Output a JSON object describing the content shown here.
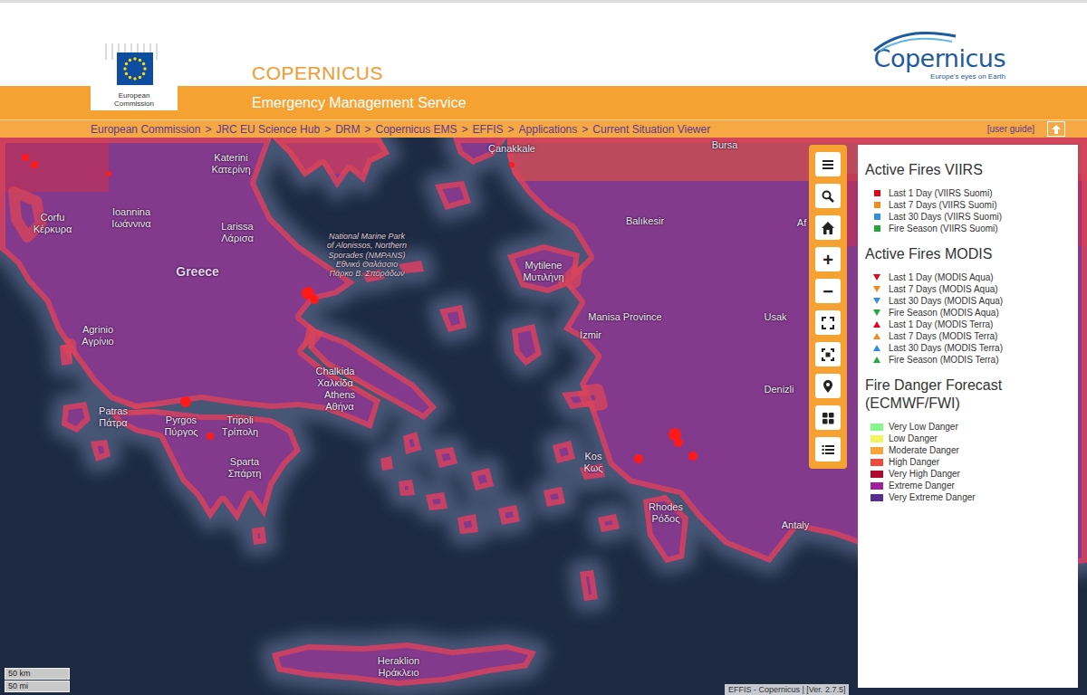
{
  "eu_logo": {
    "caption": [
      "European",
      "Commission"
    ]
  },
  "title": "COPERNICUS",
  "subtitle": "Emergency Management Service",
  "copernicus_logo": {
    "name": "Copernicus",
    "tagline": "Europe's eyes on Earth"
  },
  "breadcrumb": [
    "European Commission",
    "JRC EU Science Hub",
    "DRM",
    "Copernicus EMS",
    "EFFIS",
    "Applications",
    "Current Situation Viewer"
  ],
  "breadcrumb_separator": ">",
  "user_guide": "[user guide]",
  "toolbar": [
    {
      "kind": "menu"
    },
    {
      "kind": "search"
    },
    {
      "kind": "home"
    },
    {
      "kind": "zoom-in",
      "label": "+"
    },
    {
      "kind": "zoom-out",
      "label": "−"
    },
    {
      "kind": "fullscreen"
    },
    {
      "kind": "extent"
    },
    {
      "kind": "locate"
    },
    {
      "kind": "layers"
    },
    {
      "kind": "legend"
    }
  ],
  "legend": {
    "sections": [
      {
        "title": "Active Fires VIIRS",
        "items": [
          {
            "label": "Last 1 Day (VIIRS Suomi)",
            "kind": "square",
            "color": "#e3001b"
          },
          {
            "label": "Last 7 Days (VIIRS Suomi)",
            "kind": "square",
            "color": "#f28a1c"
          },
          {
            "label": "Last 30 Days (VIIRS Suomi)",
            "kind": "square",
            "color": "#2f8fe0"
          },
          {
            "label": "Fire Season (VIIRS Suomi)",
            "kind": "square",
            "color": "#22a83a"
          }
        ]
      },
      {
        "title": "Active Fires MODIS",
        "items": [
          {
            "label": "Last 1 Day (MODIS Aqua)",
            "kind": "triangle-down",
            "color": "#e3001b"
          },
          {
            "label": "Last 7 Days (MODIS Aqua)",
            "kind": "triangle-down",
            "color": "#f28a1c"
          },
          {
            "label": "Last 30 Days (MODIS Aqua)",
            "kind": "triangle-down",
            "color": "#2f8fe0"
          },
          {
            "label": "Fire Season (MODIS Aqua)",
            "kind": "triangle-down",
            "color": "#22a83a"
          },
          {
            "label": "Last 1 Day (MODIS Terra)",
            "kind": "triangle-up",
            "color": "#e3001b"
          },
          {
            "label": "Last 7 Days (MODIS Terra)",
            "kind": "triangle-up",
            "color": "#f28a1c"
          },
          {
            "label": "Last 30 Days (MODIS Terra)",
            "kind": "triangle-up",
            "color": "#2f8fe0"
          },
          {
            "label": "Fire Season (MODIS Terra)",
            "kind": "triangle-up",
            "color": "#22a83a"
          }
        ]
      },
      {
        "title": "Fire Danger Forecast (ECMWF/FWI)",
        "items": [
          {
            "label": "Very Low Danger",
            "kind": "swatch",
            "color": "#86f58a"
          },
          {
            "label": "Low Danger",
            "kind": "swatch",
            "color": "#f4f45c"
          },
          {
            "label": "Moderate Danger",
            "kind": "swatch",
            "color": "#f8a43a"
          },
          {
            "label": "High Danger",
            "kind": "swatch",
            "color": "#ef4a3a"
          },
          {
            "label": "Very High Danger",
            "kind": "swatch",
            "color": "#b0082b"
          },
          {
            "label": "Extreme Danger",
            "kind": "swatch",
            "color": "#a020a0"
          },
          {
            "label": "Very Extreme Danger",
            "kind": "swatch",
            "color": "#5a2d91"
          }
        ]
      }
    ]
  },
  "map": {
    "labels": [
      {
        "lines": [
          "Katerini",
          "Κατερίνη"
        ],
        "kind": "city"
      },
      {
        "lines": [
          "Ioannina",
          "Ιωάννινα"
        ],
        "kind": "city"
      },
      {
        "lines": [
          "Larissa",
          "Λάρισα"
        ],
        "kind": "city"
      },
      {
        "lines": [
          "Corfu",
          "Κέρκυρα"
        ],
        "kind": "city"
      },
      {
        "lines": [
          "Greece"
        ],
        "kind": "country"
      },
      {
        "lines": [
          "National Marine Park",
          "of Alonissos, Northern",
          "Sporades (NMPANS)",
          "Εθνικό Θαλάσσιο",
          "Πάρκο Β. Σποράδων"
        ],
        "kind": "park"
      },
      {
        "lines": [
          "Agrinio",
          "Αγρίνιο"
        ],
        "kind": "city"
      },
      {
        "lines": [
          "Chalkida",
          "Χαλκίδα"
        ],
        "kind": "city"
      },
      {
        "lines": [
          "Athens",
          "Αθήνα"
        ],
        "kind": "city"
      },
      {
        "lines": [
          "Patras",
          "Πάτρα"
        ],
        "kind": "city"
      },
      {
        "lines": [
          "Pyrgos",
          "Πύργος"
        ],
        "kind": "city"
      },
      {
        "lines": [
          "Tripoli",
          "Τρίπολη"
        ],
        "kind": "city"
      },
      {
        "lines": [
          "Sparta",
          "Σπάρτη"
        ],
        "kind": "city"
      },
      {
        "lines": [
          "Kos",
          "Κως"
        ],
        "kind": "city"
      },
      {
        "lines": [
          "Rhodes",
          "Ρόδος"
        ],
        "kind": "city"
      },
      {
        "lines": [
          "Heraklion",
          "Ηράκλειο"
        ],
        "kind": "city"
      },
      {
        "lines": [
          "Çanakkale"
        ],
        "kind": "city"
      },
      {
        "lines": [
          "Bursa"
        ],
        "kind": "city"
      },
      {
        "lines": [
          "Balıkesir"
        ],
        "kind": "city"
      },
      {
        "lines": [
          "Mytilene",
          "Μυτιλήνη"
        ],
        "kind": "city"
      },
      {
        "lines": [
          "Manisa Province"
        ],
        "kind": "city"
      },
      {
        "lines": [
          "İzmir"
        ],
        "kind": "city"
      },
      {
        "lines": [
          "Usak"
        ],
        "kind": "city"
      },
      {
        "lines": [
          "Denizli"
        ],
        "kind": "city"
      },
      {
        "lines": [
          "Antaly"
        ],
        "kind": "city"
      },
      {
        "lines": [
          "Af"
        ],
        "kind": "city"
      }
    ],
    "fires": [
      {
        "kind": "viirs-last-1-day"
      },
      {
        "kind": "viirs-last-1-day"
      },
      {
        "kind": "viirs-last-1-day"
      },
      {
        "kind": "viirs-last-1-day"
      },
      {
        "kind": "viirs-last-1-day"
      },
      {
        "kind": "viirs-last-1-day"
      },
      {
        "kind": "viirs-last-1-day"
      },
      {
        "kind": "viirs-last-1-day"
      },
      {
        "kind": "viirs-last-1-day"
      },
      {
        "kind": "viirs-last-1-day"
      },
      {
        "kind": "viirs-last-1-day"
      },
      {
        "kind": "viirs-last-1-day"
      }
    ],
    "scale": [
      "50 km",
      "50 mi"
    ],
    "attribution": "EFFIS - Copernicus | [Ver. 2.7.5]"
  }
}
